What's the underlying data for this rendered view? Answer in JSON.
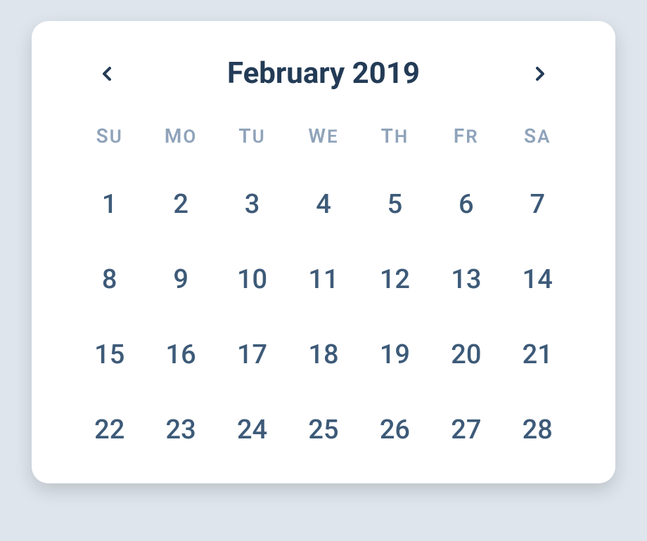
{
  "calendar": {
    "month_title": "February 2019",
    "day_headers": [
      "Su",
      "Mo",
      "Tu",
      "We",
      "Th",
      "Fr",
      "Sa"
    ],
    "weeks": [
      [
        1,
        2,
        3,
        4,
        5,
        6,
        7
      ],
      [
        8,
        9,
        10,
        11,
        12,
        13,
        14
      ],
      [
        15,
        16,
        17,
        18,
        19,
        20,
        21
      ],
      [
        22,
        23,
        24,
        25,
        26,
        27,
        28
      ]
    ]
  }
}
